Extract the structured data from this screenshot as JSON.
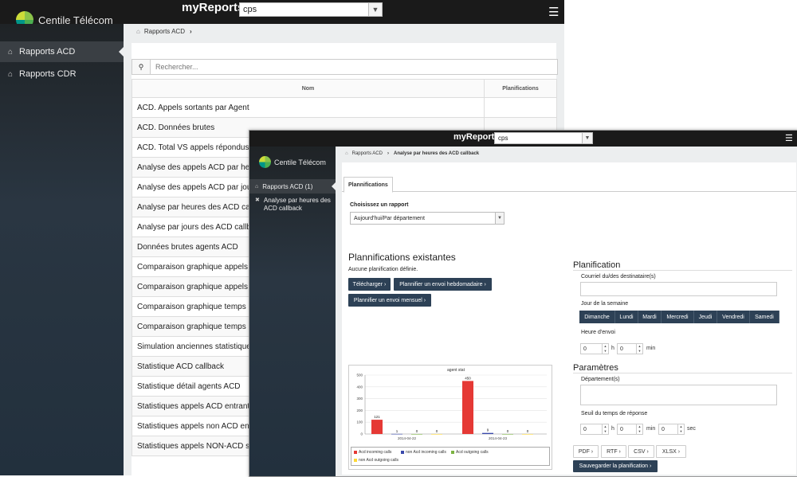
{
  "back": {
    "brand": "Centile Télécom",
    "app_title": "myReports",
    "customer_select": "cps",
    "sidebar": [
      {
        "label": "Rapports ACD",
        "active": true
      },
      {
        "label": "Rapports CDR",
        "active": false
      }
    ],
    "breadcrumb": [
      "Rapports ACD"
    ],
    "search_placeholder": "Rechercher...",
    "table": {
      "headers": [
        "Nom",
        "Planifications"
      ],
      "rows": [
        "ACD. Appels sortants par Agent",
        "ACD. Données brutes",
        "ACD. Total VS appels répondus",
        "Analyse des appels ACD par heures",
        "Analyse des appels ACD par jours",
        "Analyse par heures des ACD callback",
        "Analyse par jours des ACD callback",
        "Données brutes agents ACD",
        "Comparaison graphique appels",
        "Comparaison graphique appels",
        "Comparaison graphique temps",
        "Comparaison graphique temps",
        "Simulation anciennes statistiques",
        "Statistique ACD callback",
        "Statistique détail agents ACD",
        "Statistiques appels ACD entrants",
        "Statistiques appels non ACD entrants",
        "Statistiques appels NON-ACD sortants"
      ]
    }
  },
  "front": {
    "brand": "Centile Télécom",
    "app_title": "myReports",
    "customer_select": "cps",
    "sidebar": [
      {
        "label": "Rapports ACD (1)"
      },
      {
        "label": "Analyse par heures des ACD callback"
      }
    ],
    "breadcrumb": [
      "Rapports ACD",
      "Analyse par heures des ACD callback"
    ],
    "tab": "Plannifications",
    "choose_label": "Choisissez un rapport",
    "report_select": "Aujourd'hui/Par département",
    "existing_title": "Plannifications existantes",
    "no_schedule": "Aucune planification définie.",
    "btn_download": "Télécharger",
    "btn_weekly": "Plannifier un envoi hebdomadaire",
    "btn_monthly": "Plannifier un envoi mensuel",
    "planning_title": "Planification",
    "email_label": "Courriel du/des destinataire(s)",
    "weekday_label": "Jour de la semaine",
    "days": [
      "Dimanche",
      "Lundi",
      "Mardi",
      "Mercredi",
      "Jeudi",
      "Vendredi",
      "Samedi"
    ],
    "send_time_label": "Heure d'envoi",
    "hour_value": "0",
    "minute_value": "0",
    "unit_h": "h",
    "unit_min": "min",
    "unit_sec": "sec",
    "params_title": "Paramètres",
    "dept_label": "Département(s)",
    "threshold_label": "Seuil du temps de réponse",
    "th_h": "0",
    "th_min": "0",
    "th_sec": "0",
    "formats": [
      "PDF",
      "RTF",
      "CSV",
      "XLSX"
    ],
    "btn_save": "Sauvegarder la planification"
  },
  "chart_data": {
    "type": "bar",
    "title": "agent stat",
    "categories": [
      "2014-04-22",
      "2014-04-23"
    ],
    "ylim": [
      0,
      500
    ],
    "yticks": [
      0,
      100,
      200,
      300,
      400,
      500
    ],
    "series": [
      {
        "name": "Acd incoming calls",
        "color": "#e53935",
        "values": [
          121,
          450
        ]
      },
      {
        "name": "non Acd incoming calls",
        "color": "#3949ab",
        "values": [
          1,
          9
        ]
      },
      {
        "name": "Acd outgoing calls",
        "color": "#7cb342",
        "values": [
          0,
          0
        ]
      },
      {
        "name": "non Acd outgoing calls",
        "color": "#fdd835",
        "values": [
          0,
          0
        ]
      }
    ],
    "grid": true,
    "legend": "bottom"
  }
}
